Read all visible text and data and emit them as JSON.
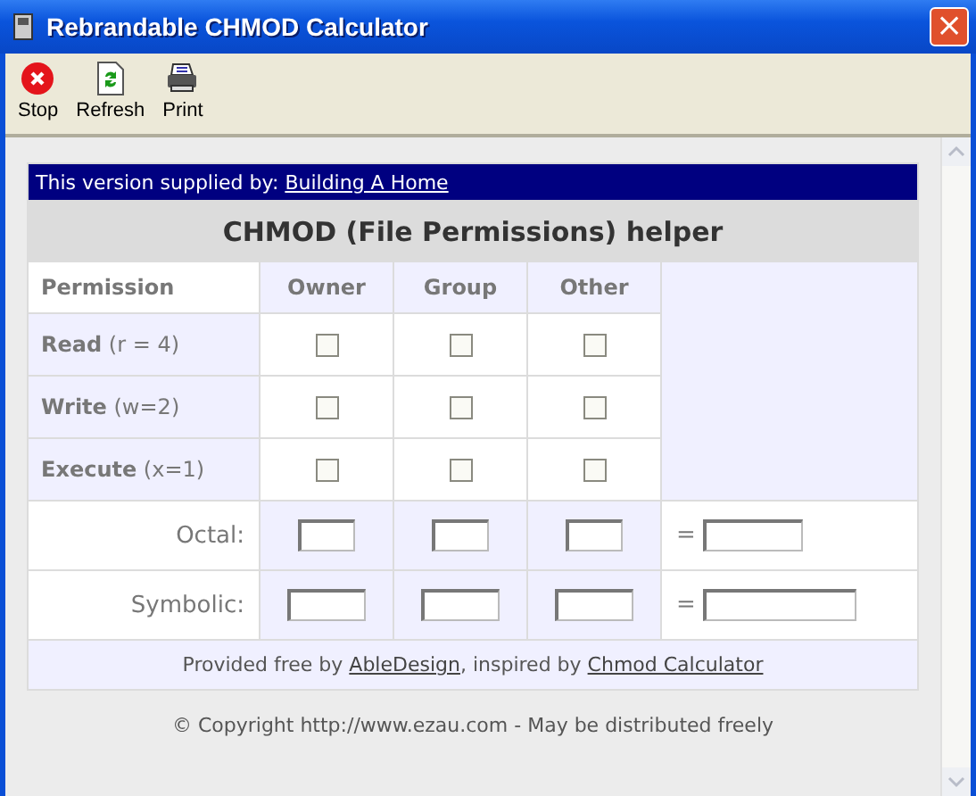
{
  "window": {
    "title": "Rebrandable CHMOD Calculator",
    "close": "×"
  },
  "toolbar": [
    {
      "label": "Stop",
      "kind": "stop"
    },
    {
      "label": "Refresh",
      "kind": "refresh"
    },
    {
      "label": "Print",
      "kind": "print"
    }
  ],
  "banner": [
    {
      "kind": "text",
      "text": "This version supplied by: "
    },
    {
      "kind": "link",
      "text": "Building A Home"
    }
  ],
  "heading": "CHMOD (File Permissions) helper",
  "columns": [
    "Permission",
    "Owner",
    "Group",
    "Other"
  ],
  "permissions": [
    {
      "label": "**Read** (r = 4)",
      "checks": [
        {
          "checked": false
        },
        {
          "checked": false
        },
        {
          "checked": false
        }
      ]
    },
    {
      "label": "**Write** (w=2)",
      "checks": [
        {
          "checked": false
        },
        {
          "checked": false
        },
        {
          "checked": false
        }
      ]
    },
    {
      "label": "**Execute** (x=1)",
      "checks": [
        {
          "checked": false
        },
        {
          "checked": false
        },
        {
          "checked": false
        }
      ]
    }
  ],
  "results": [
    {
      "kind": "octal",
      "label": "Octal:",
      "equals": "="
    },
    {
      "kind": "symbolic",
      "label": "Symbolic:",
      "equals": "="
    }
  ],
  "credits": [
    {
      "kind": "text",
      "text": "Provided free by "
    },
    {
      "kind": "link",
      "text": "AbleDesign"
    },
    {
      "kind": "text",
      "text": ", inspired by "
    },
    {
      "kind": "link",
      "text": "Chmod Calculator"
    }
  ],
  "copyright": "© Copyright http://www.ezau.com - May be distributed freely"
}
